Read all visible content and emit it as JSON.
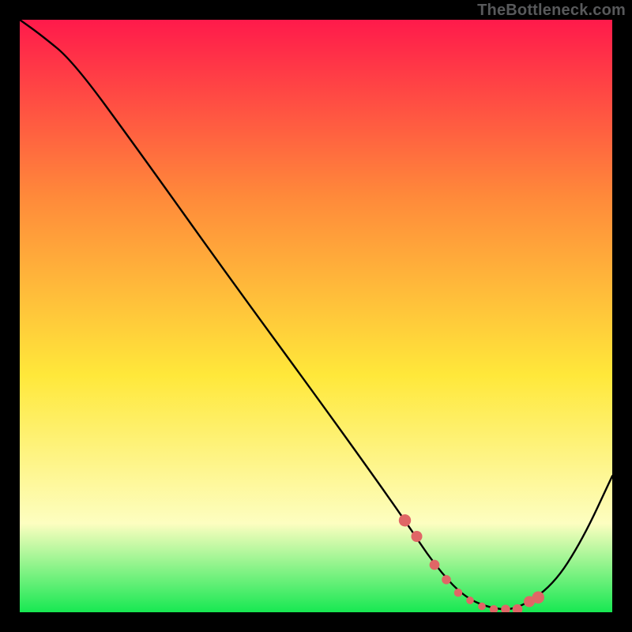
{
  "watermark": "TheBottleneck.com",
  "chart_data": {
    "type": "line",
    "title": "",
    "xlabel": "",
    "ylabel": "",
    "xlim": [
      0,
      100
    ],
    "ylim": [
      0,
      100
    ],
    "grid": false,
    "background_gradient": {
      "top": "#ff1a4b",
      "mid_upper": "#ff8a3a",
      "mid": "#ffe83a",
      "mid_lower": "#fdfec0",
      "bottom": "#17e852"
    },
    "series": [
      {
        "name": "bottleneck-curve",
        "color": "#000000",
        "x": [
          0,
          3.5,
          9,
          20,
          35,
          50,
          59,
          65,
          70,
          75,
          80,
          84,
          90,
          95,
          100
        ],
        "y": [
          100,
          97.5,
          93,
          78,
          57,
          36.5,
          24,
          15.5,
          8,
          2.5,
          0.5,
          0.5,
          4.5,
          12.3,
          23
        ]
      }
    ],
    "markers": {
      "name": "highlight-segment",
      "color": "#e06666",
      "x": [
        65,
        67,
        70,
        72,
        74,
        76,
        78,
        80,
        82,
        84,
        86,
        87.5
      ],
      "y": [
        15.5,
        12.8,
        8,
        5.5,
        3.3,
        2,
        1,
        0.5,
        0.5,
        0.5,
        1.8,
        2.5
      ]
    }
  }
}
